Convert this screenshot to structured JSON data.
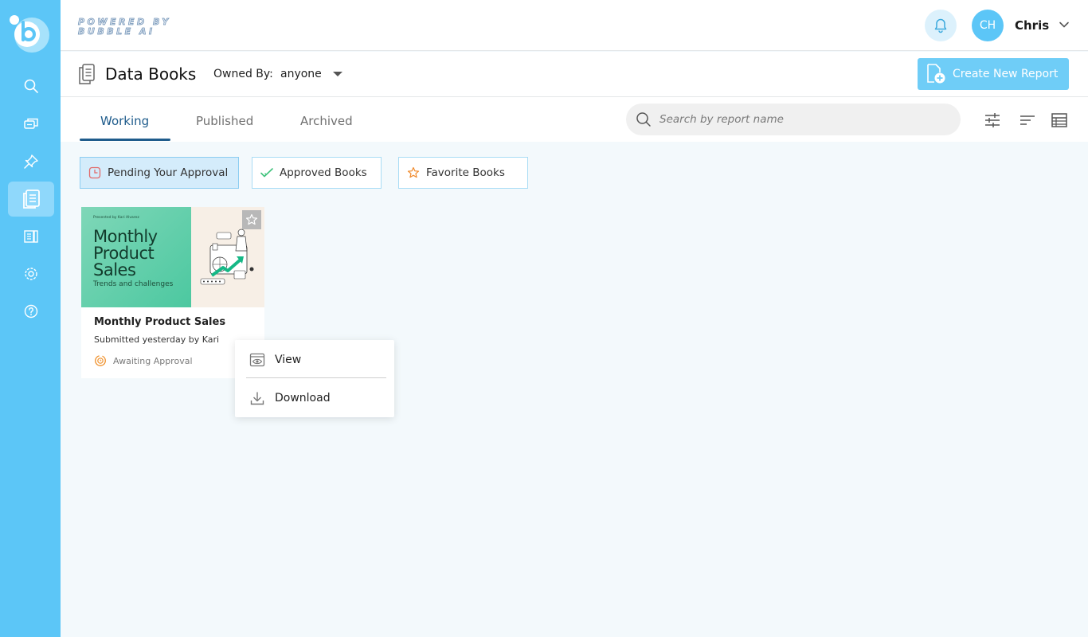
{
  "branding": {
    "powered_line1": "POWERED BY",
    "powered_line2": "BUBBLE AI"
  },
  "sidebar": {
    "items": [
      {
        "icon": "search-icon"
      },
      {
        "icon": "chat-icon"
      },
      {
        "icon": "pin-icon"
      },
      {
        "icon": "data-books-icon",
        "active": true
      },
      {
        "icon": "reports-icon"
      },
      {
        "icon": "settings-icon"
      },
      {
        "icon": "help-icon"
      }
    ]
  },
  "header": {
    "avatar_initials": "CH",
    "user_name": "Chris"
  },
  "titlebar": {
    "title": "Data Books",
    "owned_by_label": "Owned By:",
    "owned_by_value": "anyone",
    "create_button": "Create New Report"
  },
  "tabs": [
    {
      "label": "Working",
      "active": true
    },
    {
      "label": "Published"
    },
    {
      "label": "Archived"
    }
  ],
  "search": {
    "placeholder": "Search by report name",
    "value": ""
  },
  "filters": [
    {
      "label": "Pending Your Approval",
      "icon": "clock-icon",
      "active": true
    },
    {
      "label": "Approved Books",
      "icon": "check-icon"
    },
    {
      "label": "Favorite Books",
      "icon": "star-icon"
    }
  ],
  "card": {
    "thumb_presented": "Presented by Kari Alvarez",
    "thumb_title": "Monthly Product Sales",
    "thumb_subtitle": "Trends and challenges",
    "title": "Monthly Product Sales",
    "subtitle": "Submitted yesterday by Kari",
    "status": "Awaiting Approval"
  },
  "context_menu": {
    "view": "View",
    "download": "Download"
  },
  "colors": {
    "sidebar": "#5cc6f7",
    "accent": "#1f5c8c",
    "create_button": "#6fcdf7"
  }
}
